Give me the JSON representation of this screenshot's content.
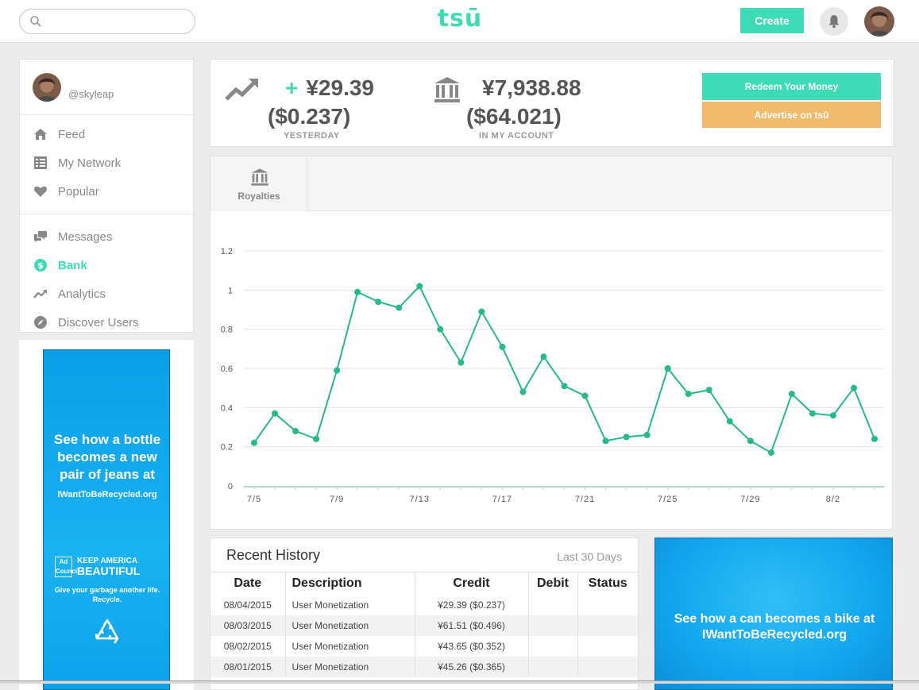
{
  "header": {
    "search_placeholder": "",
    "logo": "tsū",
    "create_label": "Create"
  },
  "user": {
    "handle": "@skyleap"
  },
  "sidebar": {
    "items": [
      {
        "label": "Feed",
        "icon": "home-icon"
      },
      {
        "label": "My Network",
        "icon": "list-icon"
      },
      {
        "label": "Popular",
        "icon": "heart-icon"
      },
      {
        "label": "Messages",
        "icon": "chat-icon"
      },
      {
        "label": "Bank",
        "icon": "dollar-icon",
        "active": true
      },
      {
        "label": "Analytics",
        "icon": "trend-icon"
      },
      {
        "label": "Discover Users",
        "icon": "compass-icon"
      }
    ]
  },
  "left_ad": {
    "headline": "See how a bottle becomes a new pair of jeans at",
    "url": "IWantToBeRecycled.org",
    "brand_box": "Ad Council",
    "brand_line1": "KEEP AMERICA",
    "brand_line2": "BEAUTIFUL",
    "tagline": "Give your garbage another life. Recycle."
  },
  "balance": {
    "yesterday_plus": "+",
    "yesterday_amount": "¥29.39",
    "yesterday_usd": "($0.237)",
    "yesterday_label": "YESTERDAY",
    "account_amount": "¥7,938.88",
    "account_usd": "($64.021)",
    "account_label": "IN MY ACCOUNT",
    "redeem_label": "Redeem Your Money",
    "advertise_label": "Advertise on tsū"
  },
  "tabs": {
    "royalties_label": "Royalties"
  },
  "chart_data": {
    "type": "line",
    "title": "",
    "xlabel": "",
    "ylabel": "",
    "ylim": [
      0,
      1.2
    ],
    "yticks": [
      "0",
      "0.2",
      "0.4",
      "0.6",
      "0.8",
      "1",
      "1.2"
    ],
    "ytick_values": [
      0,
      0.2,
      0.4,
      0.6,
      0.8,
      1,
      1.2
    ],
    "xtick_labels": [
      "7/5",
      "7/9",
      "7/13",
      "7/17",
      "7/21",
      "7/25",
      "7/29",
      "8/2"
    ],
    "xtick_indices": [
      0,
      4,
      8,
      12,
      16,
      20,
      24,
      28
    ],
    "x": [
      "7/5",
      "7/6",
      "7/7",
      "7/8",
      "7/9",
      "7/10",
      "7/11",
      "7/12",
      "7/13",
      "7/14",
      "7/15",
      "7/16",
      "7/17",
      "7/18",
      "7/19",
      "7/20",
      "7/21",
      "7/22",
      "7/23",
      "7/24",
      "7/25",
      "7/26",
      "7/27",
      "7/28",
      "7/29",
      "7/30",
      "7/31",
      "8/1",
      "8/2",
      "8/3",
      "8/4"
    ],
    "values": [
      0.22,
      0.37,
      0.28,
      0.24,
      0.59,
      0.99,
      0.94,
      0.91,
      1.02,
      0.8,
      0.63,
      0.89,
      0.71,
      0.48,
      0.66,
      0.51,
      0.46,
      0.23,
      0.25,
      0.26,
      0.6,
      0.47,
      0.49,
      0.33,
      0.23,
      0.17,
      0.47,
      0.37,
      0.36,
      0.5,
      0.24
    ],
    "grid": true,
    "color": "#27b88e"
  },
  "history": {
    "title": "Recent History",
    "range": "Last 30 Days",
    "columns": [
      "Date",
      "Description",
      "Credit",
      "Debit",
      "Status"
    ],
    "rows": [
      {
        "date": "08/04/2015",
        "desc": "User Monetization",
        "credit": "¥29.39 ($0.237)",
        "debit": "",
        "status": ""
      },
      {
        "date": "08/03/2015",
        "desc": "User Monetization",
        "credit": "¥61.51 ($0.496)",
        "debit": "",
        "status": ""
      },
      {
        "date": "08/02/2015",
        "desc": "User Monetization",
        "credit": "¥43.65 ($0.352)",
        "debit": "",
        "status": ""
      },
      {
        "date": "08/01/2015",
        "desc": "User Monetization",
        "credit": "¥45.26 ($0.365)",
        "debit": "",
        "status": ""
      }
    ]
  },
  "right_ad": {
    "text": "See how a can becomes a bike at IWantToBeRecycled.org"
  },
  "colors": {
    "accent": "#3ddbb6",
    "advertise": "#f0bb6a",
    "ad_blue": "#12a6ee"
  }
}
